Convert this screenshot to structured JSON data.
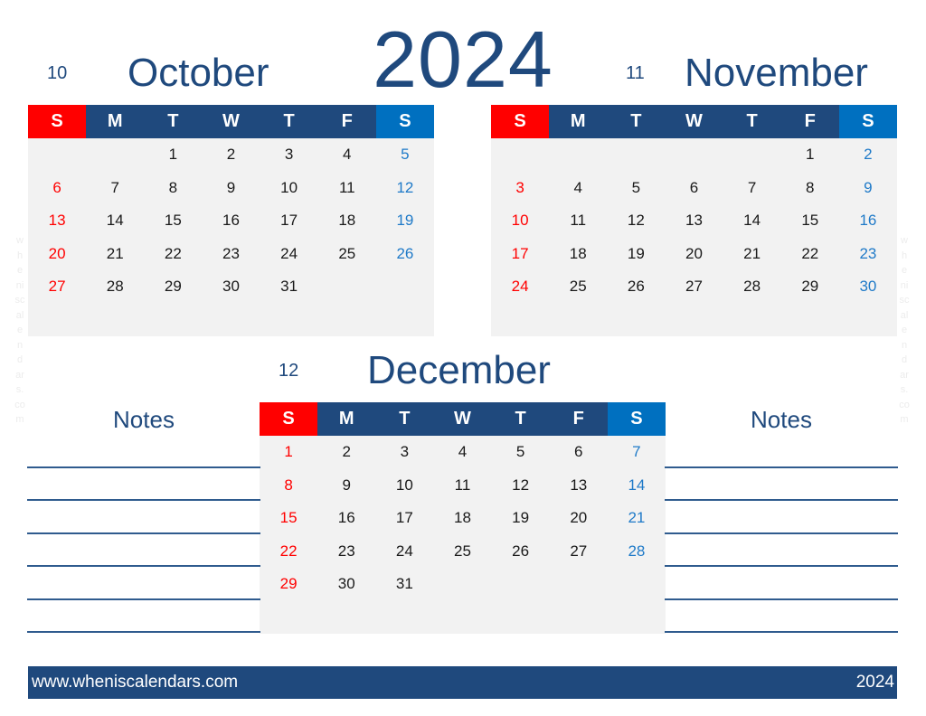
{
  "year": "2024",
  "weekday_headers": [
    "S",
    "M",
    "T",
    "W",
    "T",
    "F",
    "S"
  ],
  "months": [
    {
      "number": "10",
      "name": "October",
      "weeks": [
        [
          "",
          "",
          "1",
          "2",
          "3",
          "4",
          "5"
        ],
        [
          "6",
          "7",
          "8",
          "9",
          "10",
          "11",
          "12"
        ],
        [
          "13",
          "14",
          "15",
          "16",
          "17",
          "18",
          "19"
        ],
        [
          "20",
          "21",
          "22",
          "23",
          "24",
          "25",
          "26"
        ],
        [
          "27",
          "28",
          "29",
          "30",
          "31",
          "",
          ""
        ],
        [
          "",
          "",
          "",
          "",
          "",
          "",
          ""
        ]
      ]
    },
    {
      "number": "11",
      "name": "November",
      "weeks": [
        [
          "",
          "",
          "",
          "",
          "",
          "1",
          "2"
        ],
        [
          "3",
          "4",
          "5",
          "6",
          "7",
          "8",
          "9"
        ],
        [
          "10",
          "11",
          "12",
          "13",
          "14",
          "15",
          "16"
        ],
        [
          "17",
          "18",
          "19",
          "20",
          "21",
          "22",
          "23"
        ],
        [
          "24",
          "25",
          "26",
          "27",
          "28",
          "29",
          "30"
        ],
        [
          "",
          "",
          "",
          "",
          "",
          "",
          ""
        ]
      ]
    },
    {
      "number": "12",
      "name": "December",
      "weeks": [
        [
          "1",
          "2",
          "3",
          "4",
          "5",
          "6",
          "7"
        ],
        [
          "8",
          "9",
          "10",
          "11",
          "12",
          "13",
          "14"
        ],
        [
          "15",
          "16",
          "17",
          "18",
          "19",
          "20",
          "21"
        ],
        [
          "22",
          "23",
          "24",
          "25",
          "26",
          "27",
          "28"
        ],
        [
          "29",
          "30",
          "31",
          "",
          "",
          "",
          ""
        ],
        [
          "",
          "",
          "",
          "",
          "",
          "",
          ""
        ]
      ]
    }
  ],
  "notes": {
    "left_title": "Notes",
    "right_title": "Notes",
    "line_count": 6
  },
  "watermark_text": "wheniscalendars.com",
  "footer": {
    "website": "www.wheniscalendars.com",
    "year": "2024"
  },
  "colors": {
    "primary_blue": "#1f497d",
    "sunday_red": "#ff0000",
    "saturday_blue": "#0070c0",
    "saturday_text": "#1f7ac8",
    "cell_background": "#f2f2f2"
  }
}
